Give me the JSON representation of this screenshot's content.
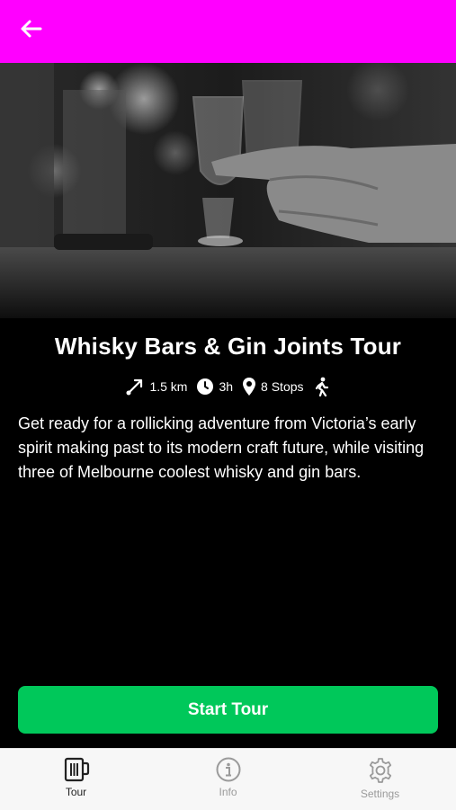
{
  "header": {
    "background": "#ff00ff",
    "back_icon": "arrow-left-icon"
  },
  "hero": {
    "image": "black-and-white photo of a hand holding a whisky glass at a bar"
  },
  "tour": {
    "title": "Whisky Bars & Gin Joints Tour",
    "distance": "1.5 km",
    "duration": "3h",
    "stops": "8 Stops",
    "mode_icon": "walking-icon",
    "description": "Get ready for a rollicking adventure from Victoria’s early spirit making past to its modern craft future, while visiting three of Melbourne coolest whisky and gin bars."
  },
  "actions": {
    "start_label": "Start Tour",
    "start_color": "#00c85a"
  },
  "tabs": [
    {
      "label": "Tour",
      "icon": "beer-mug-icon",
      "active": true
    },
    {
      "label": "Info",
      "icon": "info-icon",
      "active": false
    },
    {
      "label": "Settings",
      "icon": "gear-icon",
      "active": false
    }
  ]
}
